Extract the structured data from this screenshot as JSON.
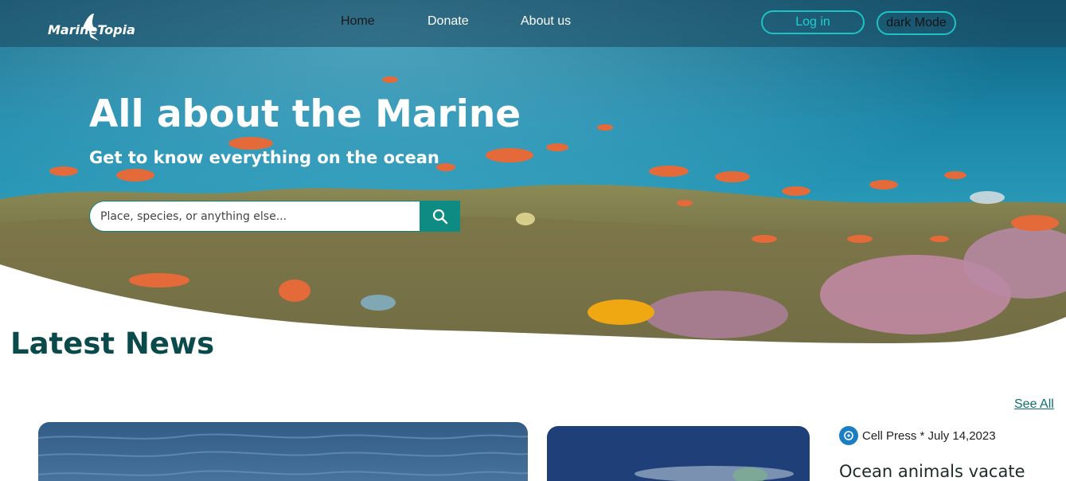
{
  "nav": {
    "logo_text": "MarineTopia",
    "links": [
      "Home",
      "Donate",
      "About us"
    ],
    "login_label": "Log in",
    "dark_mode_label": "dark Mode"
  },
  "hero": {
    "title": "All about the Marine",
    "subtitle": "Get to know everything on the ocean",
    "search_placeholder": "Place, species, or anything else..."
  },
  "news": {
    "heading": "Latest News",
    "see_all": "See All",
    "side_article": {
      "source_line": "Cell Press * July 14,2023",
      "title": "Ocean animals vacate"
    }
  },
  "icons": {
    "search": "search-icon",
    "logo": "marine-logo-icon",
    "source": "cell-press-logo-icon"
  },
  "colors": {
    "accent": "#0e8c84",
    "button_outline": "#1fc2c2",
    "heading": "#0b4a4a"
  }
}
